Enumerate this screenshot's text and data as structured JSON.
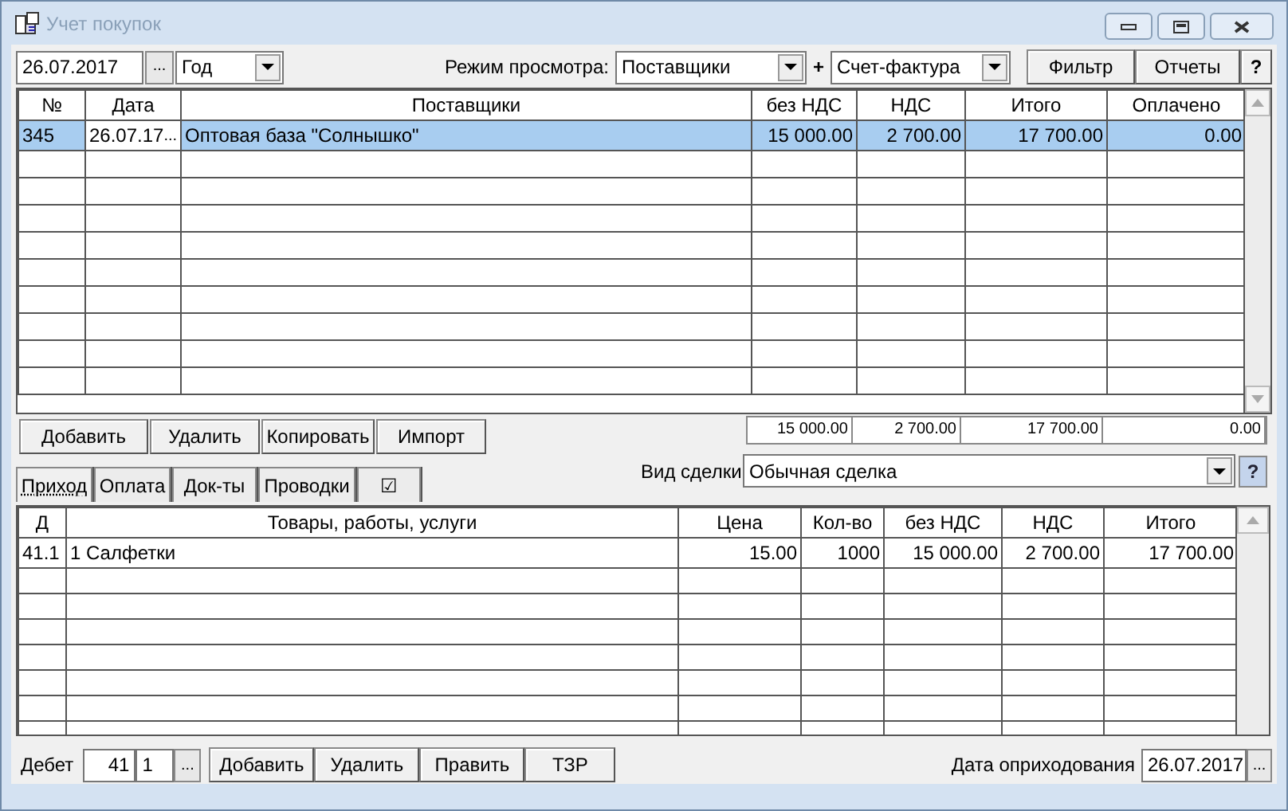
{
  "window": {
    "title": "Учет покупок"
  },
  "toolbar": {
    "date": "26.07.2017",
    "date_button": "...",
    "period": "Год",
    "view_mode_label": "Режим просмотра:",
    "view_mode": "Поставщики",
    "plus": "+",
    "document_type": "Счет-фактура",
    "buttons": [
      "Фильтр",
      "Отчеты",
      "?"
    ]
  },
  "purchases_table": {
    "columns": [
      "№",
      "Дата",
      "Поставщики",
      "без НДС",
      "НДС",
      "Итого",
      "Оплачено"
    ],
    "rows": [
      {
        "cells": [
          "345",
          "26.07.17",
          "Оптовая база \"Солнышко\"",
          "15 000.00",
          "2 700.00",
          "17 700.00",
          "0.00"
        ],
        "selected": true,
        "date_button": "..."
      }
    ],
    "totals": [
      "15 000.00",
      "2 700.00",
      "17 700.00",
      "0.00"
    ]
  },
  "table_buttons": [
    "Добавить",
    "Удалить",
    "Копировать",
    "Импорт"
  ],
  "deal_type": {
    "label": "Вид сделки",
    "value": "Обычная сделка",
    "help": "?"
  },
  "tabs": [
    {
      "label": "Приход",
      "selected": true
    },
    {
      "label": "Оплата",
      "selected": false
    },
    {
      "label": "Док-ты",
      "selected": false
    },
    {
      "label": "Проводки",
      "selected": false
    },
    {
      "label": "☑",
      "selected": false
    }
  ],
  "items_table": {
    "columns": [
      "Д",
      "Товары, работы, услуги",
      "Цена",
      "Кол-во",
      "без НДС",
      "НДС",
      "Итого"
    ],
    "rows": [
      {
        "cells": [
          "41.1",
          "1 Салфетки",
          "15.00",
          "1000",
          "15 000.00",
          "2 700.00",
          "17 700.00"
        ]
      }
    ]
  },
  "footer": {
    "debit_label": "Дебет",
    "debit_account": "41",
    "debit_subaccount": "1",
    "debit_button": "...",
    "buttons": [
      "Добавить",
      "Удалить",
      "Править",
      "ТЗР"
    ],
    "posting_date_label": "Дата оприходования",
    "posting_date": "26.07.2017",
    "posting_date_button": "..."
  }
}
